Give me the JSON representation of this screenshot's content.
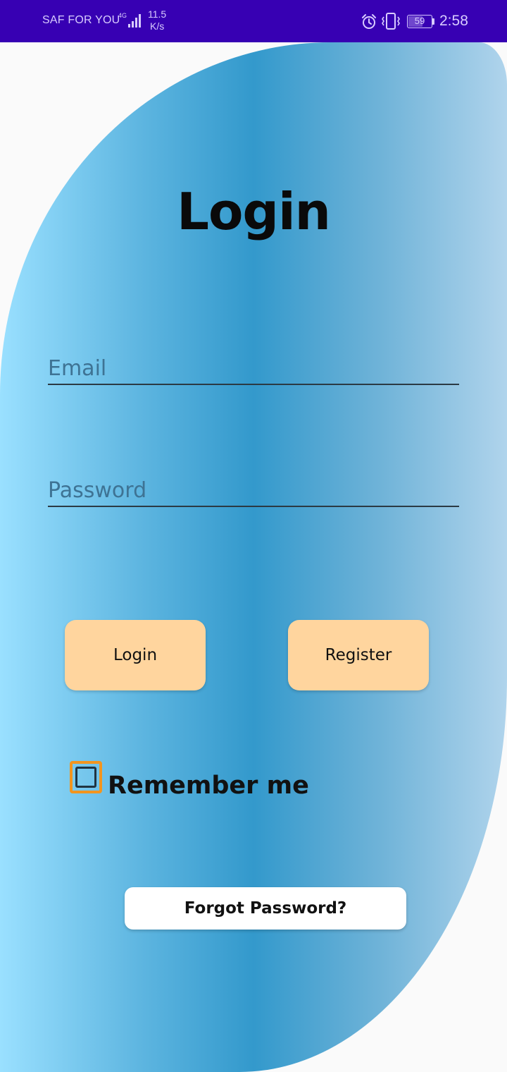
{
  "status_bar": {
    "carrier": "SAF FOR YOU",
    "network_type": "4G",
    "net_speed_value": "11.5",
    "net_speed_unit": "K/s",
    "battery_level": "59",
    "battery_fraction": 0.59,
    "time": "2:58",
    "icons": [
      "signal-icon",
      "alarm-icon",
      "vibrate-icon",
      "battery-icon"
    ],
    "background_color": "#3700b3"
  },
  "login_screen": {
    "title": "Login",
    "email_placeholder": "Email",
    "password_placeholder": "Password",
    "login_label": "Login",
    "register_label": "Register",
    "remember_label": "Remember me",
    "remember_checked": false,
    "forgot_label": "Forgot Password?",
    "accent_color": "#ffd59e",
    "checkbox_color": "#f2951f"
  }
}
